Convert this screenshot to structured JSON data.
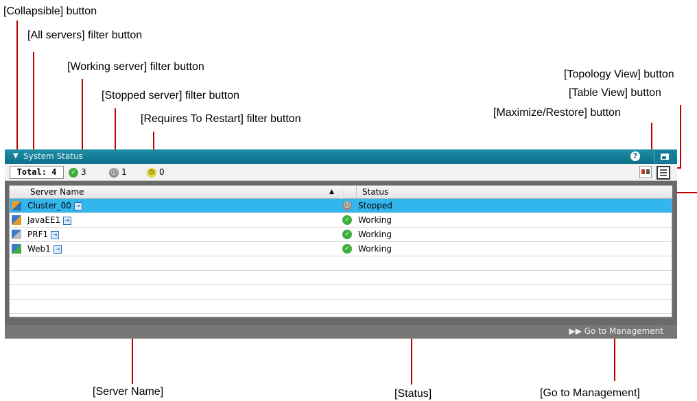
{
  "callouts": {
    "collapsible": "[Collapsible]  button",
    "all_servers": "[All servers]  filter button",
    "working": "[Working server]   filter button",
    "stopped": "[Stopped server]   filter button",
    "restart": "[Requires To Restart]   filter button",
    "topology": "[Topology View]  button",
    "table_view": "[Table View]  button",
    "maximize": "[Maximize/Restore]   button",
    "server_name": "[Server Name]",
    "status": "[Status]",
    "go_to_management": "[Go to Management]"
  },
  "widget": {
    "title": "System Status",
    "help_glyph": "?",
    "filters": {
      "total_label": "Total: 4",
      "working_count": "3",
      "stopped_count": "1",
      "restart_count": "0"
    },
    "table": {
      "columns": {
        "name": "Server Name",
        "sort_glyph": "▲",
        "status": "Status"
      },
      "rows": [
        {
          "name": "Cluster_00",
          "status": "Stopped",
          "status_kind": "stopped",
          "selected": true
        },
        {
          "name": "JavaEE1",
          "status": "Working",
          "status_kind": "working"
        },
        {
          "name": "PRF1",
          "status": "Working",
          "status_kind": "working"
        },
        {
          "name": "Web1",
          "status": "Working",
          "status_kind": "working"
        }
      ]
    },
    "footer": {
      "go_to_management": "▶▶ Go to Management"
    }
  },
  "colors": {
    "title_bar": "#0b6f88",
    "selected_row": "#33b6ee",
    "working": "#3fae3f",
    "stopped": "#8c8c8c",
    "restart": "#e2d53c",
    "leader": "#c00000"
  },
  "icons": [
    "collapse-triangle-icon",
    "help-icon",
    "maximize-icon",
    "working-status-icon",
    "stopped-status-icon",
    "restart-status-icon",
    "topology-view-icon",
    "table-view-icon",
    "cluster-icon",
    "server-icon",
    "open-link-icon"
  ]
}
